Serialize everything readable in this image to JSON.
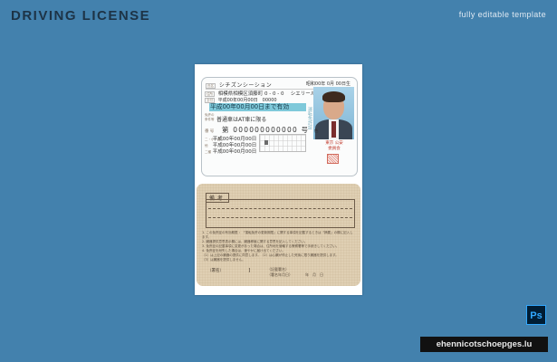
{
  "header": {
    "title": "DRIVING LICENSE",
    "subtitle": "fully editable template"
  },
  "front": {
    "name_label": "氏名",
    "name": "シチズンシーション",
    "dob": "昭和00年 0月 00日生",
    "address_label": "住所",
    "address": "相模県相模区須藤町 0 - 0 - 0 　シエリール000",
    "issue_label": "交付",
    "issue": "平成00年00月00日　00000",
    "expiry": "平成00年00月00日まで有効",
    "conditions_label_1": "免許の",
    "conditions_label_2": "条件等",
    "conditions": "普通車はAT車に限る",
    "seal_text": "運転免許証",
    "number_label": "番号",
    "license_number": "第 000000000000 号",
    "color": "色",
    "lic_rows": [
      {
        "tag": "二・小・原",
        "value": "平成00年00月00日"
      },
      {
        "tag": "他",
        "value": "平成00年00月00日"
      },
      {
        "tag": "二種",
        "value": "平成00年00月00日"
      }
    ],
    "publisher_1": "東京 公安",
    "publisher_2": "委員会"
  },
  "back": {
    "remarks_label": "備考",
    "notes": [
      "1. この免許証の有効期限 ：「運転免許の更新期限」に関する事項を記載するときは「摘要」の欄に記入します。",
      "2. 臓器提供意思表示欄には、臓器移植に関する意思を記入してください。",
      "3. 免許証の記載事項に変更があった場合は、住所地を管轄する警察署等で手続きしてください。",
      "4. 免許証を紛失した場合は、速やかに届け出てください。",
      "（1）は上記の臓器の提供に同意します。（2）は心臓が停止した死後に限り臓器を提供します。",
      "（3）は臓器を提供しません。"
    ],
    "signature_label": "（署名）",
    "signature_bracket": "】",
    "family_sign_1": "（記載署名）",
    "family_sign_2": "（署名年月日）　　　　年　月　日"
  },
  "badges": {
    "ps": "Ps",
    "watermark": "ehennicotschoepges.lu"
  }
}
